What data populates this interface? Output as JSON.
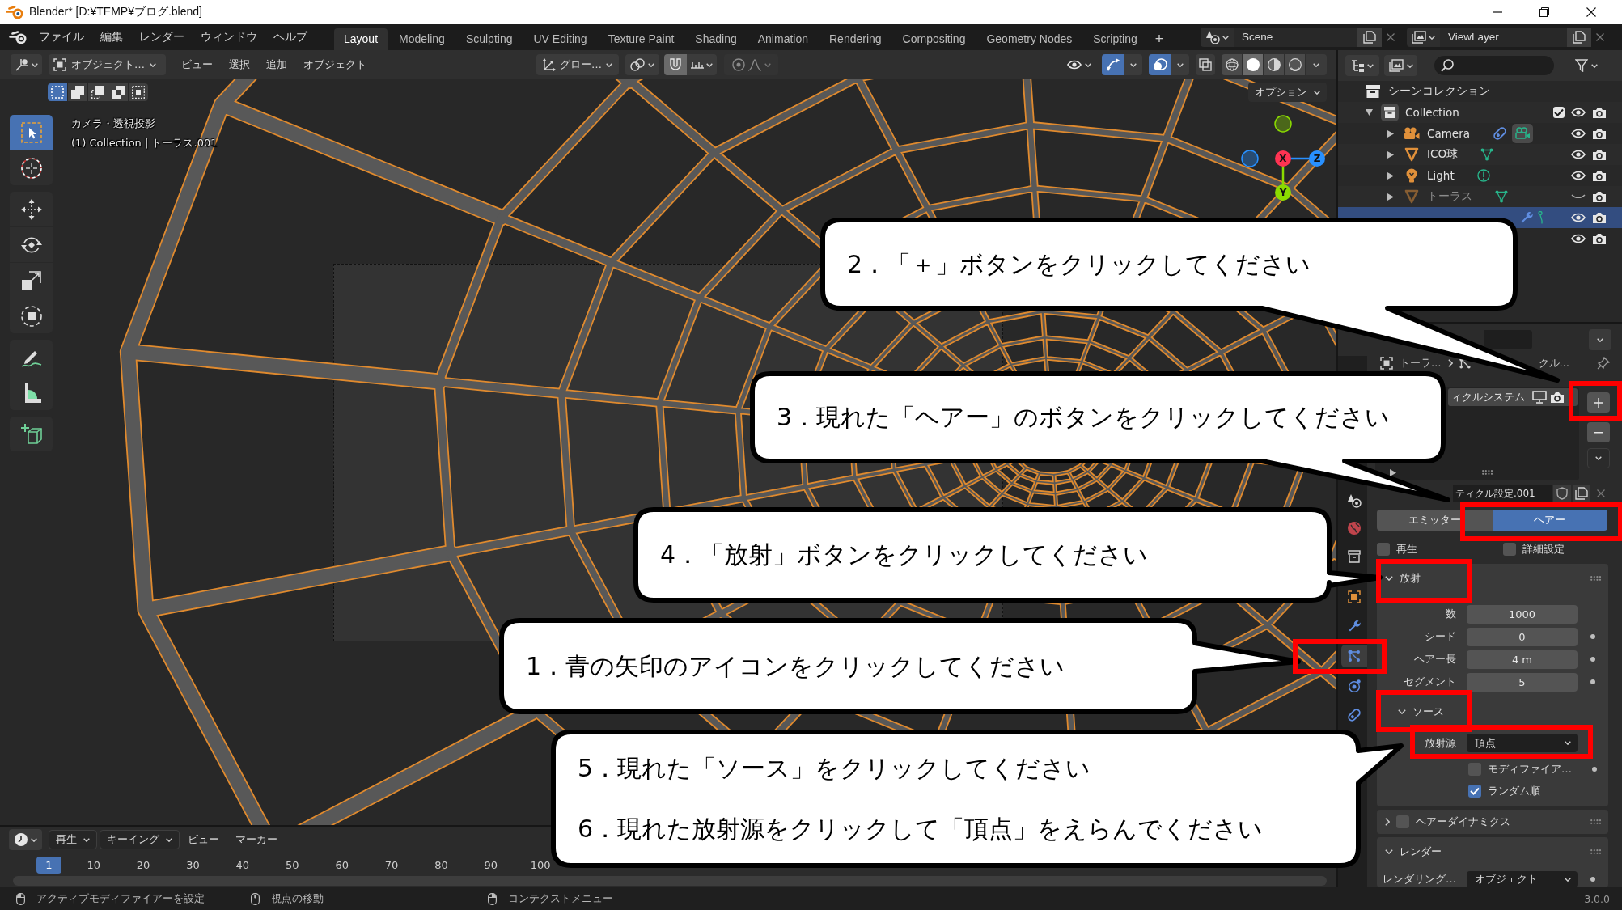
{
  "window": {
    "title": "Blender* [D:¥TEMP¥ブログ.blend]"
  },
  "menu": [
    "ファイル",
    "編集",
    "レンダー",
    "ウィンドウ",
    "ヘルプ"
  ],
  "workspaces": [
    {
      "label": "Layout",
      "selected": true
    },
    {
      "label": "Modeling",
      "selected": false
    },
    {
      "label": "Sculpting",
      "selected": false
    },
    {
      "label": "UV Editing",
      "selected": false
    },
    {
      "label": "Texture Paint",
      "selected": false
    },
    {
      "label": "Shading",
      "selected": false
    },
    {
      "label": "Animation",
      "selected": false
    },
    {
      "label": "Rendering",
      "selected": false
    },
    {
      "label": "Compositing",
      "selected": false
    },
    {
      "label": "Geometry Nodes",
      "selected": false
    },
    {
      "label": "Scripting",
      "selected": false
    }
  ],
  "add_workspace": "+",
  "scene": "Scene",
  "view_layer": "ViewLayer",
  "viewport": {
    "mode": "オブジェクト…",
    "menus": [
      "ビュー",
      "選択",
      "追加",
      "オブジェクト"
    ],
    "orientation": "グロー…",
    "snapping_on": true,
    "proportional_on": false,
    "gizmos_on": true,
    "overlays_on": true,
    "shading": [
      {
        "kind": "wireframe",
        "selected": false
      },
      {
        "kind": "solid",
        "selected": true
      },
      {
        "kind": "material",
        "selected": false
      },
      {
        "kind": "rendered",
        "selected": false
      }
    ],
    "select_modes": [
      {
        "kind": "new",
        "selected": true
      },
      {
        "kind": "extend",
        "selected": false
      },
      {
        "kind": "subtract",
        "selected": false
      },
      {
        "kind": "difference",
        "selected": false
      },
      {
        "kind": "intersect",
        "selected": false
      }
    ],
    "options": "オプション",
    "info": [
      "カメラ・透視投影",
      "(1) Collection | トーラス.001"
    ],
    "tools": [
      [
        {
          "kind": "select_box",
          "selected": true
        },
        {
          "kind": "cursor",
          "selected": false
        }
      ],
      [
        {
          "kind": "move",
          "selected": false
        },
        {
          "kind": "rotate",
          "selected": false
        },
        {
          "kind": "scale",
          "selected": false
        },
        {
          "kind": "transform",
          "selected": false
        }
      ],
      [
        {
          "kind": "annotate",
          "selected": false
        },
        {
          "kind": "measure",
          "selected": false
        }
      ],
      [
        {
          "kind": "add_cube",
          "selected": false
        }
      ]
    ],
    "gizmo_axes": [
      {
        "label": "X",
        "color": "#ff3352"
      },
      {
        "label": "Y",
        "color": "#8bdc00"
      },
      {
        "label": "Z",
        "color": "#2890ff"
      }
    ]
  },
  "outliner": {
    "root": {
      "name": "シーンコレクション",
      "children": [
        {
          "name": "Collection",
          "kind": "collection",
          "expanded": true,
          "checked": true,
          "visible": true,
          "selected": false,
          "children": [
            {
              "name": "Camera",
              "kind": "camera",
              "expanded": false,
              "visible": true,
              "selected": false
            },
            {
              "name": "ICO球",
              "kind": "mesh",
              "expanded": false,
              "visible": true,
              "selected": false
            },
            {
              "name": "Light",
              "kind": "light",
              "expanded": false,
              "visible": true,
              "selected": false
            },
            {
              "name": "トーラス",
              "kind": "mesh",
              "expanded": false,
              "visible": false,
              "selected": false
            },
            {
              "kind": "mesh_particles",
              "visible": true,
              "selected": true
            },
            {
              "visible": true
            }
          ]
        }
      ]
    }
  },
  "properties": {
    "tabs": [
      {
        "kind": "scene",
        "selected": false
      },
      {
        "kind": "world",
        "selected": false
      },
      {
        "kind": "collection",
        "selected": false
      },
      {
        "kind": "object",
        "selected": false
      },
      {
        "kind": "modifiers",
        "selected": false
      },
      {
        "kind": "particles",
        "selected": true
      },
      {
        "kind": "physics",
        "selected": false
      },
      {
        "kind": "constraints",
        "selected": false
      }
    ],
    "breadcrumb": [
      "トーラ…",
      "クル…"
    ],
    "systems": [
      {
        "name": "ィクルシステム",
        "selected": true
      }
    ],
    "settings_name": "ティクル設定.001",
    "types": [
      {
        "label": "エミッター",
        "selected": false
      },
      {
        "label": "ヘアー",
        "selected": true
      }
    ],
    "options": [
      {
        "label": "再生",
        "checked": false
      },
      {
        "label": "詳細設定",
        "checked": false
      }
    ],
    "panels": [
      {
        "title": "放射",
        "expanded": true,
        "rows": [
          {
            "kind": "number",
            "label": "数",
            "value": "1000",
            "animatable": false
          },
          {
            "kind": "number",
            "label": "シード",
            "value": "0",
            "animatable": true
          },
          {
            "kind": "number",
            "label": "ヘアー長",
            "value": "4 m",
            "animatable": true
          },
          {
            "kind": "number",
            "label": "セグメント",
            "value": "5",
            "animatable": true
          },
          {
            "kind": "subpanel",
            "title": "ソース",
            "expanded": true,
            "rows": [
              {
                "kind": "dropdown",
                "label": "放射源",
                "value": "頂点",
                "animatable": false
              },
              {
                "kind": "checkbox",
                "label": "モディファイア…",
                "checked": false,
                "animatable": true
              },
              {
                "kind": "checkbox",
                "label": "ランダム順",
                "checked": true,
                "animatable": false
              }
            ]
          }
        ]
      },
      {
        "title": "ヘアーダイナミクス",
        "expanded": false,
        "enabled": false
      },
      {
        "title": "レンダー",
        "expanded": true,
        "rows": [
          {
            "kind": "dropdown",
            "label": "レンダリング…",
            "value": "オブジェクト",
            "animatable": true
          }
        ]
      }
    ]
  },
  "timeline": {
    "editor_menus": [
      {
        "label": "再生",
        "kind": "dropdown"
      },
      {
        "label": "キーイング",
        "kind": "dropdown"
      },
      {
        "label": "ビュー",
        "kind": "menu"
      },
      {
        "label": "マーカー",
        "kind": "menu"
      }
    ],
    "current_frame": "1",
    "frames": [
      "10",
      "20",
      "30",
      "40",
      "50",
      "60",
      "70",
      "80",
      "90",
      "100"
    ]
  },
  "status_bar": {
    "hints": [
      {
        "kind": "left",
        "label": "アクティブモディファイアーを設定"
      },
      {
        "kind": "middle",
        "label": "視点の移動"
      },
      {
        "kind": "right",
        "label": "コンテクストメニュー"
      }
    ],
    "version": "3.0.0"
  },
  "callouts": [
    {
      "lines": [
        "2．「＋」ボタンをクリックしてください"
      ]
    },
    {
      "lines": [
        "3．現れた「ヘアー」のボタンをクリックしてください"
      ]
    },
    {
      "lines": [
        "4．「放射」ボタンをクリックしてください"
      ]
    },
    {
      "lines": [
        "1．青の矢印のアイコンをクリックしてください"
      ]
    },
    {
      "lines": [
        "5．現れた「ソース」をクリックしてください",
        "6．現れた放射源をクリックして「頂点」をえらんでください"
      ]
    }
  ]
}
